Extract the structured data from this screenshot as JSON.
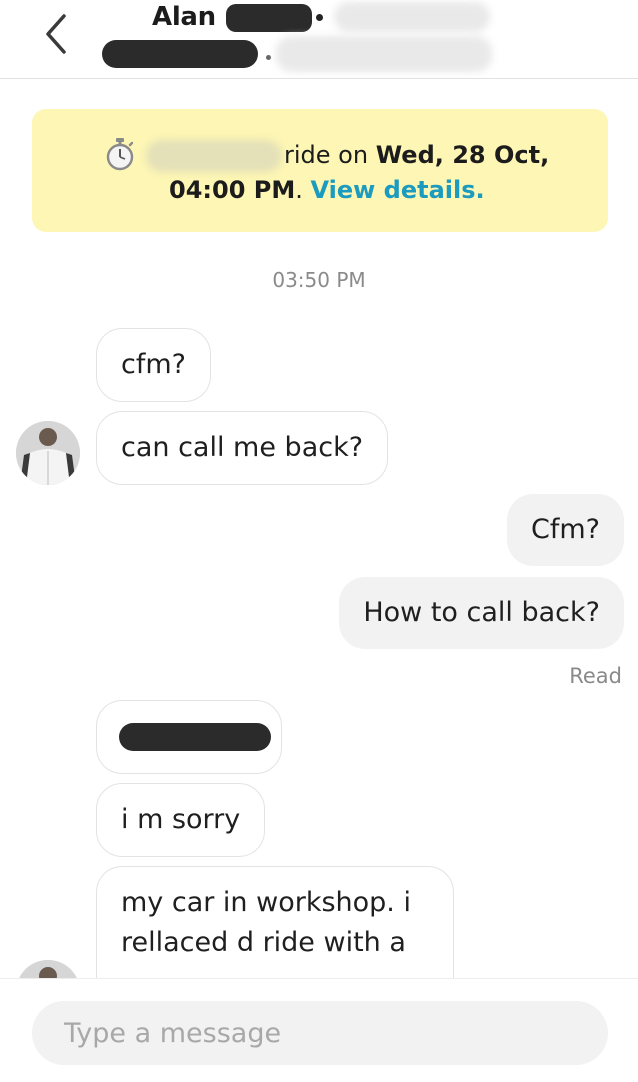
{
  "header": {
    "title": "Alan",
    "back_icon": "chevron-left-icon"
  },
  "banner": {
    "icon": "stopwatch-icon",
    "text_prefix": "ride on ",
    "date": "Wed, 28 Oct,",
    "time": "04:00 PM",
    "separator": ". ",
    "link": "View details."
  },
  "chat": {
    "timestamp": "03:50 PM",
    "messages": [
      {
        "direction": "incoming",
        "text": "cfm?"
      },
      {
        "direction": "incoming",
        "text": "can call me back?"
      },
      {
        "direction": "outgoing",
        "text": "Cfm?"
      },
      {
        "direction": "outgoing",
        "text": "How to call back?"
      },
      {
        "direction": "incoming",
        "text": ""
      },
      {
        "direction": "incoming",
        "text": "i m sorry"
      },
      {
        "direction": "incoming",
        "text": "my car in workshop. i rellaced d ride with a"
      }
    ],
    "read_status": "Read"
  },
  "composer": {
    "placeholder": "Type a message"
  },
  "colors": {
    "banner_bg": "#fdf6b4",
    "link": "#1b9bbf",
    "outgoing_bubble": "#f2f2f2",
    "redaction": "#2b2b2b"
  }
}
